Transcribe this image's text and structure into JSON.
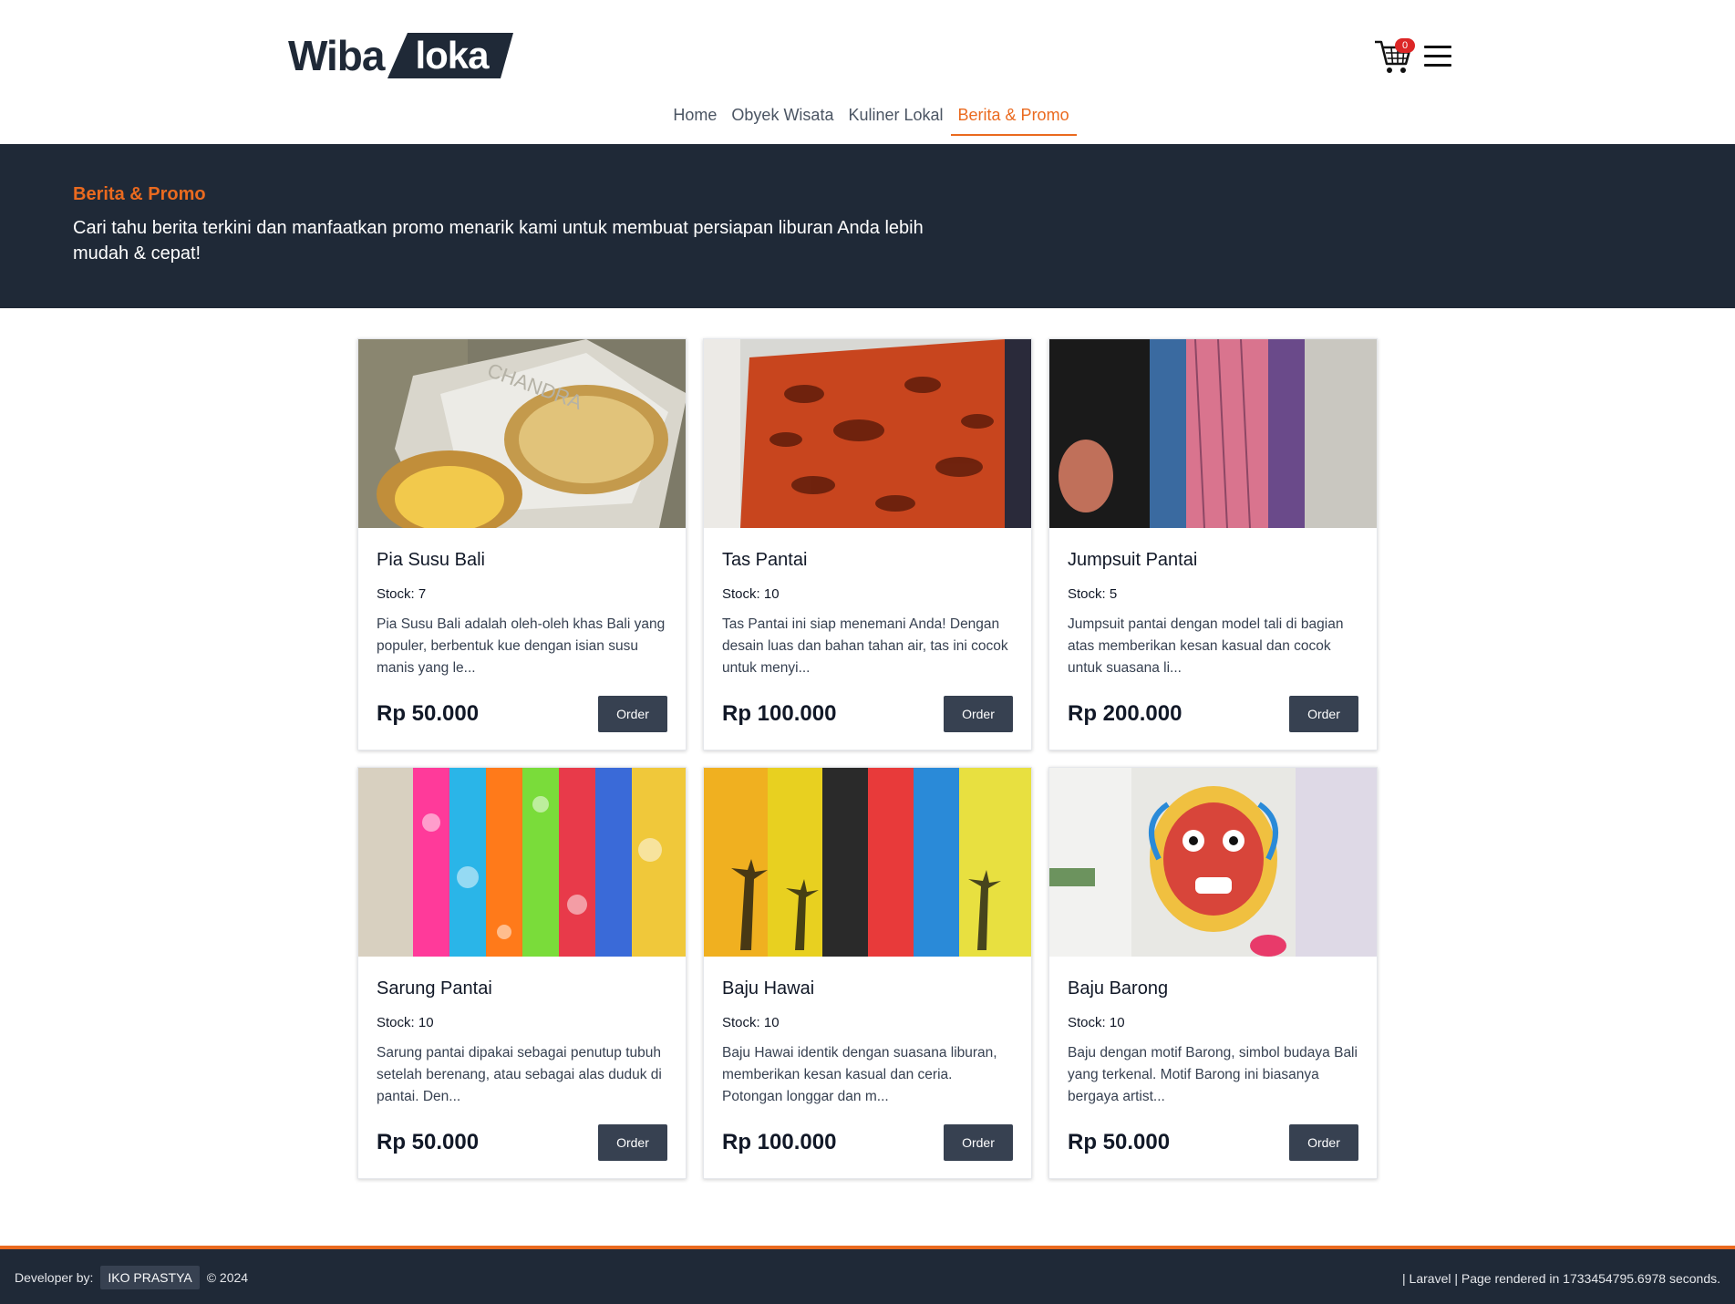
{
  "header": {
    "logo_left": "Wiba",
    "logo_right": "loka",
    "cart_count": "0"
  },
  "nav": [
    {
      "label": "Home"
    },
    {
      "label": "Obyek Wisata"
    },
    {
      "label": "Kuliner Lokal"
    },
    {
      "label": "Berita & Promo"
    }
  ],
  "hero": {
    "title": "Berita & Promo",
    "description": "Cari tahu berita terkini dan manfaatkan promo menarik kami untuk membuat persiapan liburan Anda lebih mudah & cepat!"
  },
  "products": [
    {
      "title": "Pia Susu Bali",
      "stock": "Stock: 7",
      "description": "Pia Susu Bali adalah oleh-oleh khas Bali yang populer, berbentuk kue dengan isian susu manis yang le...",
      "price": "Rp 50.000",
      "order_label": "Order"
    },
    {
      "title": "Tas Pantai",
      "stock": "Stock: 10",
      "description": "Tas Pantai ini siap menemani Anda! Dengan desain luas dan bahan tahan air, tas ini cocok untuk menyi...",
      "price": "Rp 100.000",
      "order_label": "Order"
    },
    {
      "title": "Jumpsuit Pantai",
      "stock": "Stock: 5",
      "description": "Jumpsuit pantai dengan model tali di bagian atas memberikan kesan kasual dan cocok untuk suasana li...",
      "price": "Rp 200.000",
      "order_label": "Order"
    },
    {
      "title": "Sarung Pantai",
      "stock": "Stock: 10",
      "description": "Sarung pantai dipakai sebagai penutup tubuh setelah berenang, atau sebagai alas duduk di pantai. Den...",
      "price": "Rp 50.000",
      "order_label": "Order"
    },
    {
      "title": "Baju Hawai",
      "stock": "Stock: 10",
      "description": "Baju Hawai identik dengan suasana liburan, memberikan kesan kasual dan ceria. Potongan longgar dan m...",
      "price": "Rp 100.000",
      "order_label": "Order"
    },
    {
      "title": "Baju Barong",
      "stock": "Stock: 10",
      "description": "Baju dengan motif Barong, simbol budaya Bali yang terkenal. Motif Barong ini biasanya bergaya artist...",
      "price": "Rp 50.000",
      "order_label": "Order"
    }
  ],
  "footer": {
    "developer_label": "Developer by:",
    "developer_name": "IKO PRASTYA",
    "copyright": "© 2024",
    "render_info": "| Laravel | Page rendered in 1733454795.6978 seconds."
  },
  "colors": {
    "accent": "#ea6a1f",
    "dark": "#1f2937",
    "button": "#374151"
  }
}
